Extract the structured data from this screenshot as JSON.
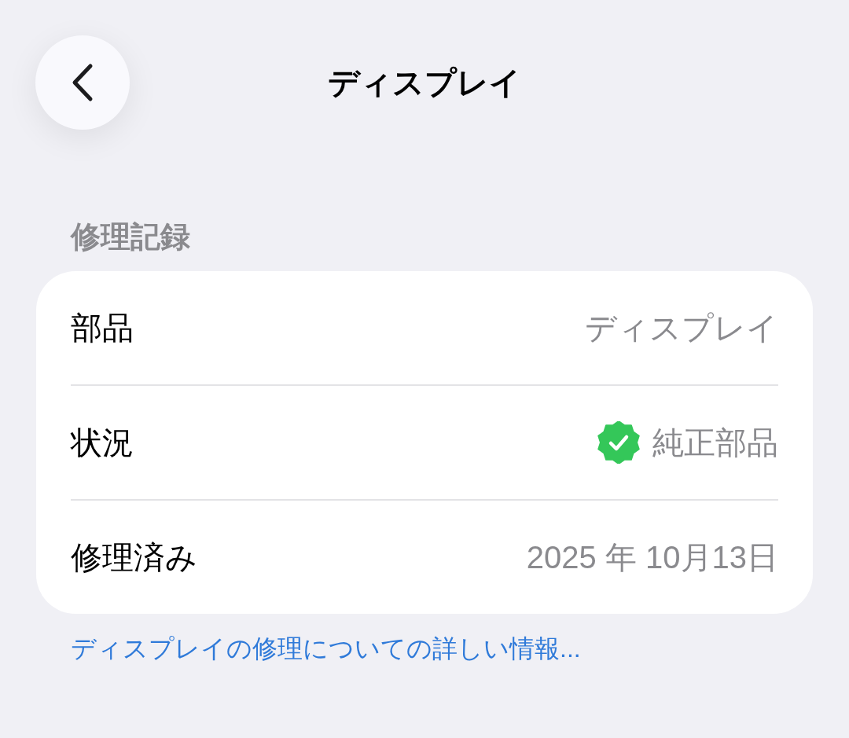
{
  "nav": {
    "title": "ディスプレイ"
  },
  "section": {
    "header": "修理記録"
  },
  "rows": [
    {
      "kind": "text",
      "label": "部品",
      "value": "ディスプレイ"
    },
    {
      "kind": "verified",
      "label": "状況",
      "value": "純正部品"
    },
    {
      "kind": "text",
      "label": "修理済み",
      "value": "2025 年 10月13日"
    }
  ],
  "footer": {
    "link": "ディスプレイの修理についての詳しい情報..."
  }
}
